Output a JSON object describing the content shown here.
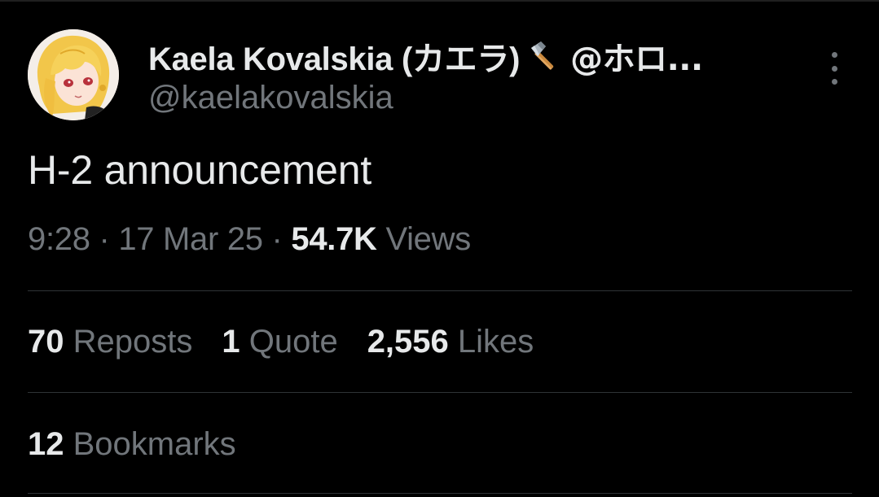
{
  "author": {
    "display_name": "Kaela Kovalskia (カエラ)",
    "name_suffix": "@ホロ...",
    "badge_icon": "hammer-icon",
    "handle": "@kaelakovalskia"
  },
  "tweet": {
    "text": "H-2 announcement"
  },
  "meta": {
    "time": "9:28",
    "separator_1": " · ",
    "date": "17 Mar 25",
    "separator_2": " · ",
    "views_count": "54.7K",
    "views_label": " Views"
  },
  "stats": {
    "reposts_count": "70",
    "reposts_label": " Reposts",
    "quotes_count": "1",
    "quotes_label": " Quote",
    "likes_count": "2,556",
    "likes_label": " Likes",
    "bookmarks_count": "12",
    "bookmarks_label": " Bookmarks"
  },
  "colors": {
    "background": "#000000",
    "primary_text": "#e7e9ea",
    "secondary_text": "#71767b",
    "divider": "#2f3336"
  }
}
